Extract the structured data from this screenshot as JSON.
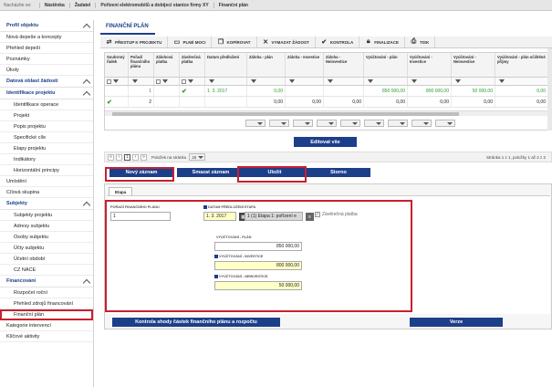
{
  "breadcrumb": {
    "label": "Nacházíte se:",
    "items": [
      "Nástěnka",
      "Žadatel",
      "Pořízení elektromobilů a dobíjecí stanice firmy XY",
      "Finanční plán"
    ]
  },
  "sidebar": {
    "sections": [
      {
        "title": "Profil objektu",
        "items": [
          {
            "label": "Nová depeše a koncepty"
          },
          {
            "label": "Přehled depeší"
          },
          {
            "label": "Poznámky"
          },
          {
            "label": "Úkoly"
          }
        ]
      },
      {
        "title": "Datová oblast žádosti",
        "items": []
      },
      {
        "title": "Identifikace projektu",
        "items": [
          {
            "label": "Identifikace operace"
          },
          {
            "label": "Projekt"
          },
          {
            "label": "Popis projektu"
          },
          {
            "label": "Specifické cíle"
          },
          {
            "label": "Etapy projektu"
          },
          {
            "label": "Indikátory"
          },
          {
            "label": "Horizontální principy"
          }
        ]
      },
      {
        "title": "",
        "items": [
          {
            "label": "Umístění",
            "top": true
          },
          {
            "label": "Cílová skupina",
            "top": true
          }
        ]
      },
      {
        "title": "Subjekty",
        "items": [
          {
            "label": "Subjekty projektu"
          },
          {
            "label": "Adresy subjektu"
          },
          {
            "label": "Osoby subjektu"
          },
          {
            "label": "Účty subjektu"
          },
          {
            "label": "Účetní období"
          },
          {
            "label": "CZ NACE"
          }
        ]
      },
      {
        "title": "Financování",
        "items": [
          {
            "label": "Rozpočet roční"
          },
          {
            "label": "Přehled zdrojů financování"
          },
          {
            "label": "Finanční plán",
            "active": true
          }
        ]
      },
      {
        "title": "",
        "items": [
          {
            "label": "Kategorie intervencí",
            "top": true
          },
          {
            "label": "Klíčové aktivity",
            "top": true
          }
        ]
      }
    ]
  },
  "page": {
    "title": "FINANČNÍ PLÁN"
  },
  "toolbar": {
    "items": [
      {
        "label": "PŘESTUP K PROJEKTU",
        "icon": "arrows-icon"
      },
      {
        "label": "PLNÉ MOCI",
        "icon": "monitor-icon"
      },
      {
        "label": "KOPÍROVAT",
        "icon": "copy-icon"
      },
      {
        "label": "VYMAZAT ŽÁDOST",
        "icon": "cross-icon"
      },
      {
        "label": "KONTROLA",
        "icon": "check-icon"
      },
      {
        "label": "FINALIZACE",
        "icon": "lock-icon"
      },
      {
        "label": "TISK",
        "icon": "print-icon"
      }
    ]
  },
  "grid": {
    "columns": [
      "Souhrnný řádek",
      "Pořadí finančního plánu",
      "Zálohová platba",
      "Závěrečná platba",
      "Datum předložení",
      "Záloha - plán",
      "Záloha - Investice",
      "Záloha - Neinvestice",
      "Vyúčtování - plán",
      "Vyúčtování - Investice",
      "Vyúčtování - Neinvestice",
      "Vyúčtování - plán očištěné příjmy"
    ],
    "rows": [
      [
        "",
        "1",
        "",
        "✔",
        "1. 3. 2017",
        "0,00",
        "",
        "",
        "850 000,00",
        "800 000,00",
        "50 000,00",
        "0,00"
      ],
      [
        "✔",
        "2",
        "",
        "",
        "",
        "0,00",
        "0,00",
        "0,00",
        "0,00",
        "0,00",
        "0,00",
        "0,00"
      ]
    ]
  },
  "edit_all_label": "Editovat vše",
  "pager": {
    "current_page": "1",
    "per_page_label": "Položek na stránku",
    "per_page_value": "25",
    "info": "Stránka 1 z 1, položky 1 až 2 z 2"
  },
  "actions": {
    "new_label": "Nový záznam",
    "delete_label": "Smazat záznam",
    "save_label": "Uložit",
    "cancel_label": "Storno"
  },
  "form": {
    "tab_label": "Etapa",
    "order_label": "POŘADÍ FINANČNÍHO PLÁNU",
    "order_value": "1",
    "date_label": "DATUM PŘEDLOŽENÍ",
    "date_value": "1. 3. 2017",
    "stage_label": "ETAPA",
    "stage_value": "1 (1) Etapa 1: pořízení e",
    "final_payment_label": "Závěrečná platba",
    "billing_plan_label": "VYÚČTOVÁNÍ - PLÁN",
    "billing_plan_value": "850 000,00",
    "billing_invest_label": "VYÚČTOVÁNÍ - INVESTICE",
    "billing_invest_value": "800 000,00",
    "billing_noninvest_label": "VYÚČTOVÁNÍ - NEINVESTICE",
    "billing_noninvest_value": "50 000,00",
    "check_button_label": "Kontrola shody částek finančního plánu a rozpočtu",
    "version_button_label": "Verze"
  }
}
